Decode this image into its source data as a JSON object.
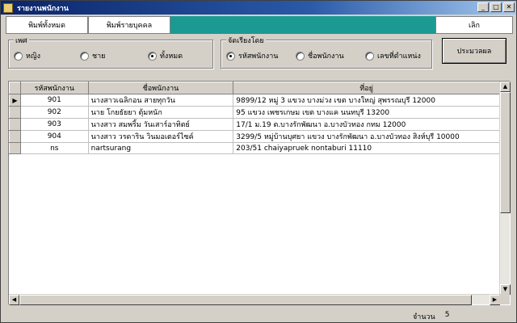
{
  "window": {
    "title": "รายงานพนักงาน"
  },
  "toolbar": {
    "print_all": "พิมพ์ทั้งหมด",
    "print_person": "พิมพ์รายบุคคล",
    "cancel": "เลิก"
  },
  "gender_group": {
    "legend": "เพศ",
    "options": [
      {
        "label": "หญิง",
        "selected": false
      },
      {
        "label": "ชาย",
        "selected": false
      },
      {
        "label": "ทั้งหมด",
        "selected": true
      }
    ]
  },
  "sort_group": {
    "legend": "จัดเรียงโดย",
    "options": [
      {
        "label": "รหัสพนักงาน",
        "selected": true
      },
      {
        "label": "ชื่อพนักงาน",
        "selected": false
      },
      {
        "label": "เลขที่ตำแหน่ง",
        "selected": false
      }
    ]
  },
  "process_button": "ประมวลผล",
  "grid": {
    "columns": [
      "รหัสพนักงาน",
      "ชื่อพนักงาน",
      "ที่อยู่"
    ],
    "rows": [
      {
        "code": "901",
        "name": "นางสาวเฉลิกอน สายทุกวัน",
        "address": "9899/12 หมู่ 3 แขวง บางม่วง เขต บางใหญ่ สุพรรณบุรี 12000"
      },
      {
        "code": "902",
        "name": "นาย โกยธัยยา ตุ้มหนัก",
        "address": "95 แขวง เพชรเกษม เขต บางแค นนทบุรี 13200"
      },
      {
        "code": "903",
        "name": "นางสาว สมพริ้ม วันเสาร์อาทิตย์",
        "address": "17/1 ม.19 ต.บางรักพัฒนา อ.บางบัวทอง กทม 12000"
      },
      {
        "code": "904",
        "name": "นางสาว วรดาริน วินมอเตอร์ไซค์",
        "address": "3299/5 หมู่บ้านบุศยา แขวง บางรักพัฒนา อ.บางบัวทอง สิงห์บุรี 10000"
      },
      {
        "code": "ns",
        "name": "nartsurang",
        "address": "203/51   chaiyapruek  nontaburi  11110"
      }
    ]
  },
  "footer": {
    "count_label": "จำนวน",
    "count_value": "5"
  }
}
